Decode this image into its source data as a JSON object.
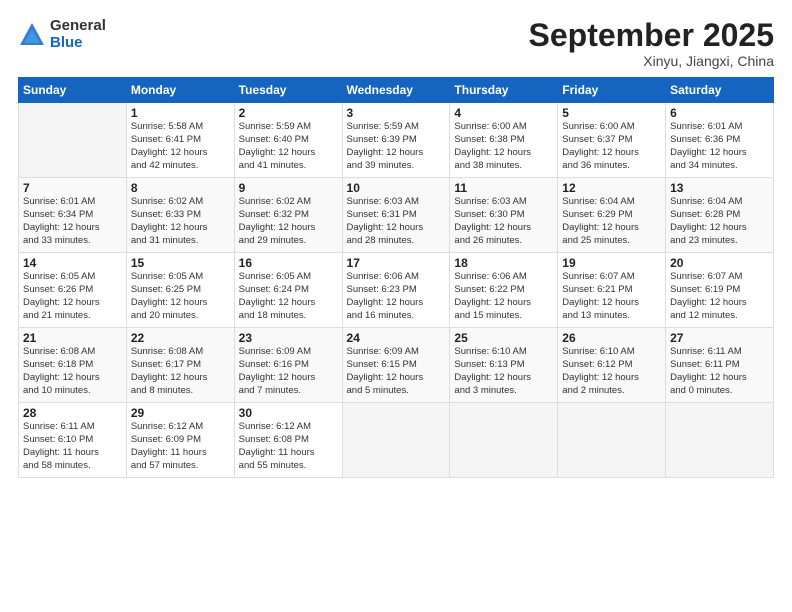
{
  "logo": {
    "general": "General",
    "blue": "Blue"
  },
  "title": "September 2025",
  "location": "Xinyu, Jiangxi, China",
  "days_of_week": [
    "Sunday",
    "Monday",
    "Tuesday",
    "Wednesday",
    "Thursday",
    "Friday",
    "Saturday"
  ],
  "weeks": [
    [
      {
        "day": "",
        "info": ""
      },
      {
        "day": "1",
        "info": "Sunrise: 5:58 AM\nSunset: 6:41 PM\nDaylight: 12 hours\nand 42 minutes."
      },
      {
        "day": "2",
        "info": "Sunrise: 5:59 AM\nSunset: 6:40 PM\nDaylight: 12 hours\nand 41 minutes."
      },
      {
        "day": "3",
        "info": "Sunrise: 5:59 AM\nSunset: 6:39 PM\nDaylight: 12 hours\nand 39 minutes."
      },
      {
        "day": "4",
        "info": "Sunrise: 6:00 AM\nSunset: 6:38 PM\nDaylight: 12 hours\nand 38 minutes."
      },
      {
        "day": "5",
        "info": "Sunrise: 6:00 AM\nSunset: 6:37 PM\nDaylight: 12 hours\nand 36 minutes."
      },
      {
        "day": "6",
        "info": "Sunrise: 6:01 AM\nSunset: 6:36 PM\nDaylight: 12 hours\nand 34 minutes."
      }
    ],
    [
      {
        "day": "7",
        "info": "Sunrise: 6:01 AM\nSunset: 6:34 PM\nDaylight: 12 hours\nand 33 minutes."
      },
      {
        "day": "8",
        "info": "Sunrise: 6:02 AM\nSunset: 6:33 PM\nDaylight: 12 hours\nand 31 minutes."
      },
      {
        "day": "9",
        "info": "Sunrise: 6:02 AM\nSunset: 6:32 PM\nDaylight: 12 hours\nand 29 minutes."
      },
      {
        "day": "10",
        "info": "Sunrise: 6:03 AM\nSunset: 6:31 PM\nDaylight: 12 hours\nand 28 minutes."
      },
      {
        "day": "11",
        "info": "Sunrise: 6:03 AM\nSunset: 6:30 PM\nDaylight: 12 hours\nand 26 minutes."
      },
      {
        "day": "12",
        "info": "Sunrise: 6:04 AM\nSunset: 6:29 PM\nDaylight: 12 hours\nand 25 minutes."
      },
      {
        "day": "13",
        "info": "Sunrise: 6:04 AM\nSunset: 6:28 PM\nDaylight: 12 hours\nand 23 minutes."
      }
    ],
    [
      {
        "day": "14",
        "info": "Sunrise: 6:05 AM\nSunset: 6:26 PM\nDaylight: 12 hours\nand 21 minutes."
      },
      {
        "day": "15",
        "info": "Sunrise: 6:05 AM\nSunset: 6:25 PM\nDaylight: 12 hours\nand 20 minutes."
      },
      {
        "day": "16",
        "info": "Sunrise: 6:05 AM\nSunset: 6:24 PM\nDaylight: 12 hours\nand 18 minutes."
      },
      {
        "day": "17",
        "info": "Sunrise: 6:06 AM\nSunset: 6:23 PM\nDaylight: 12 hours\nand 16 minutes."
      },
      {
        "day": "18",
        "info": "Sunrise: 6:06 AM\nSunset: 6:22 PM\nDaylight: 12 hours\nand 15 minutes."
      },
      {
        "day": "19",
        "info": "Sunrise: 6:07 AM\nSunset: 6:21 PM\nDaylight: 12 hours\nand 13 minutes."
      },
      {
        "day": "20",
        "info": "Sunrise: 6:07 AM\nSunset: 6:19 PM\nDaylight: 12 hours\nand 12 minutes."
      }
    ],
    [
      {
        "day": "21",
        "info": "Sunrise: 6:08 AM\nSunset: 6:18 PM\nDaylight: 12 hours\nand 10 minutes."
      },
      {
        "day": "22",
        "info": "Sunrise: 6:08 AM\nSunset: 6:17 PM\nDaylight: 12 hours\nand 8 minutes."
      },
      {
        "day": "23",
        "info": "Sunrise: 6:09 AM\nSunset: 6:16 PM\nDaylight: 12 hours\nand 7 minutes."
      },
      {
        "day": "24",
        "info": "Sunrise: 6:09 AM\nSunset: 6:15 PM\nDaylight: 12 hours\nand 5 minutes."
      },
      {
        "day": "25",
        "info": "Sunrise: 6:10 AM\nSunset: 6:13 PM\nDaylight: 12 hours\nand 3 minutes."
      },
      {
        "day": "26",
        "info": "Sunrise: 6:10 AM\nSunset: 6:12 PM\nDaylight: 12 hours\nand 2 minutes."
      },
      {
        "day": "27",
        "info": "Sunrise: 6:11 AM\nSunset: 6:11 PM\nDaylight: 12 hours\nand 0 minutes."
      }
    ],
    [
      {
        "day": "28",
        "info": "Sunrise: 6:11 AM\nSunset: 6:10 PM\nDaylight: 11 hours\nand 58 minutes."
      },
      {
        "day": "29",
        "info": "Sunrise: 6:12 AM\nSunset: 6:09 PM\nDaylight: 11 hours\nand 57 minutes."
      },
      {
        "day": "30",
        "info": "Sunrise: 6:12 AM\nSunset: 6:08 PM\nDaylight: 11 hours\nand 55 minutes."
      },
      {
        "day": "",
        "info": ""
      },
      {
        "day": "",
        "info": ""
      },
      {
        "day": "",
        "info": ""
      },
      {
        "day": "",
        "info": ""
      }
    ]
  ]
}
